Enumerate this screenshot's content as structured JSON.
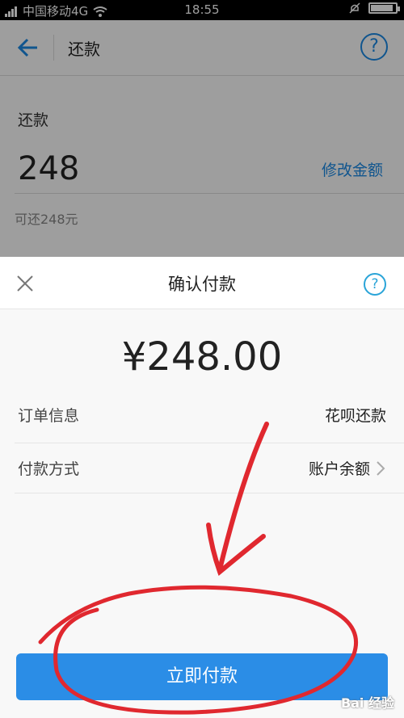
{
  "status": {
    "left": "中国移动4G",
    "time": "18:55",
    "battery_level": 0.9
  },
  "nav": {
    "title": "还款",
    "help": "?"
  },
  "card": {
    "label": "还款",
    "amount": "248",
    "modify": "修改金额",
    "available": "可还248元"
  },
  "sheet": {
    "title": "确认付款",
    "help": "?",
    "amount": "¥248.00",
    "rows": [
      {
        "key": "订单信息",
        "value": "花呗还款"
      },
      {
        "key": "付款方式",
        "value": "账户余额"
      }
    ],
    "pay_button": "立即付款"
  },
  "watermark": "Bai 经验",
  "colors": {
    "accent": "#1a8ae6",
    "button": "#2b8de6",
    "annotation": "#e0282f"
  },
  "icons": [
    "back-arrow-icon",
    "help-icon",
    "close-icon",
    "chevron-right-icon",
    "signal-icon",
    "wifi-icon",
    "battery-icon"
  ]
}
